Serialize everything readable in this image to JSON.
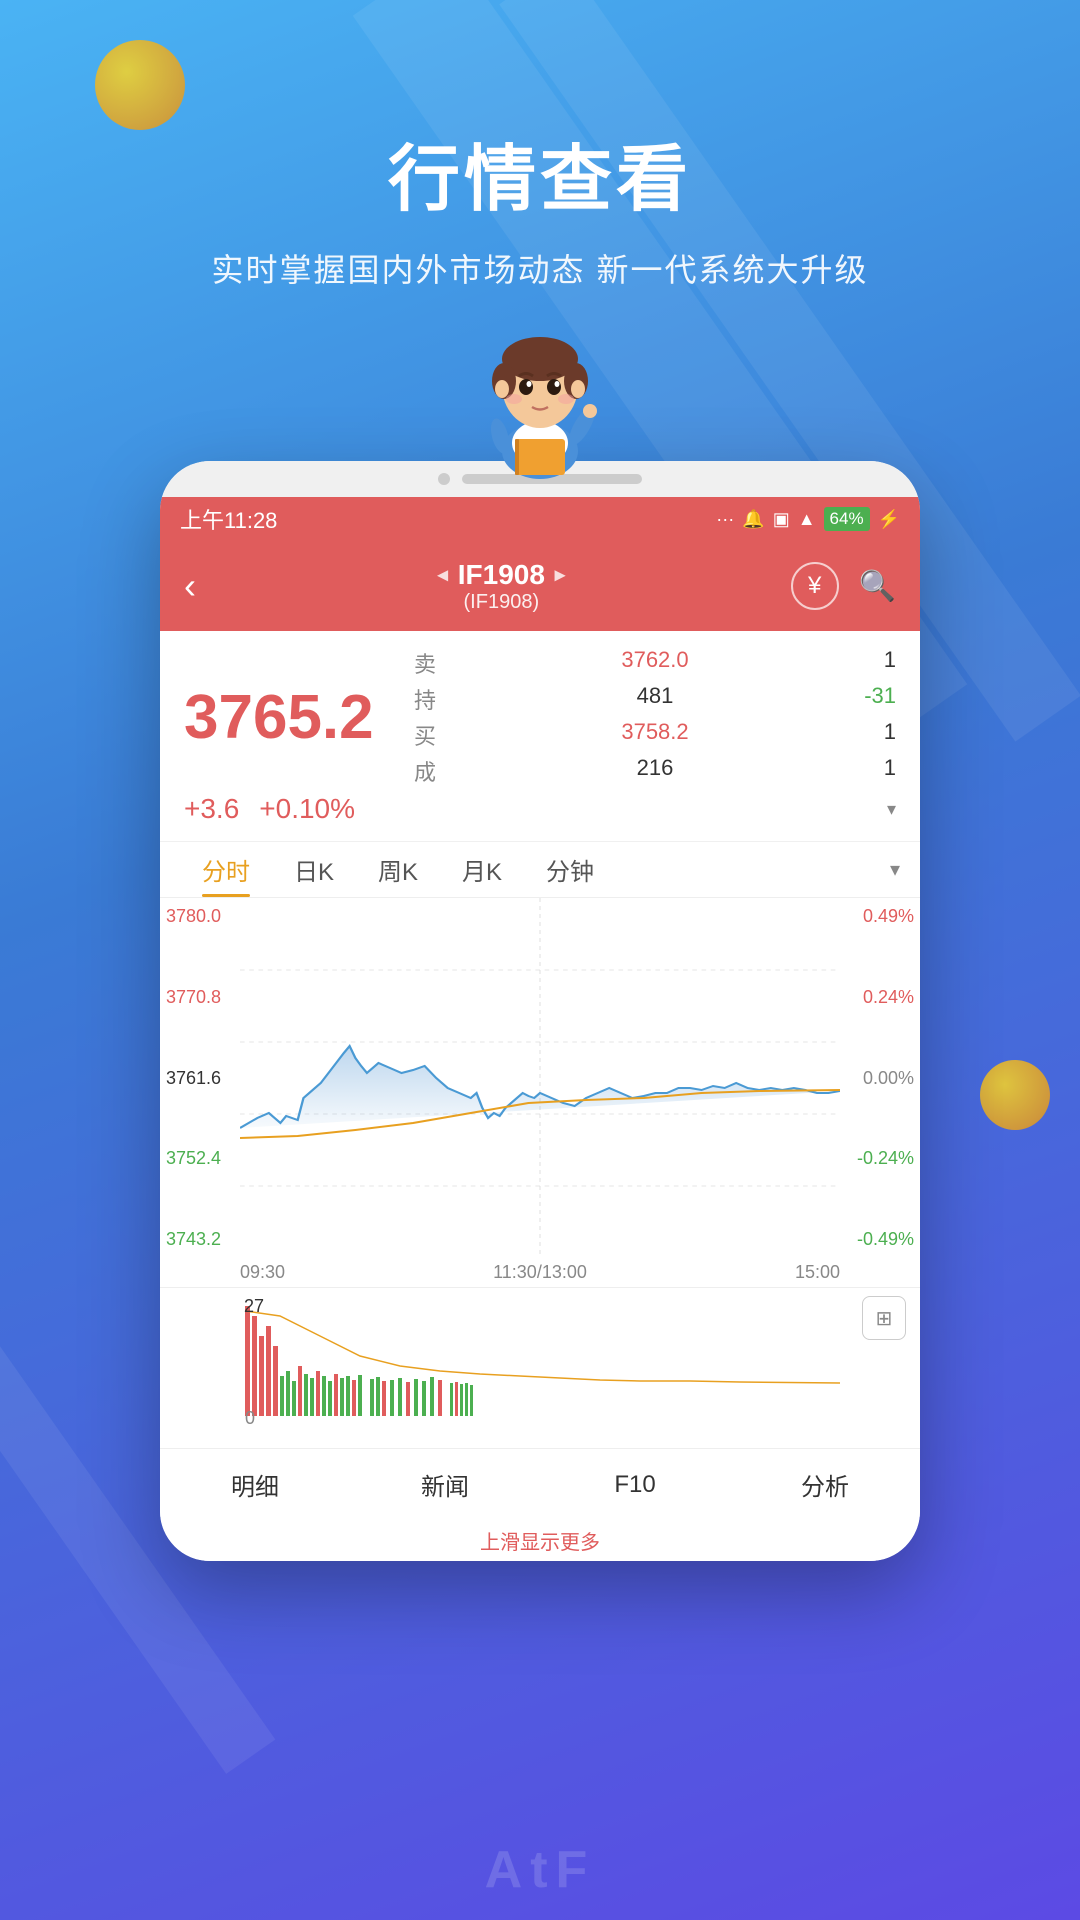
{
  "background": {
    "gradient_start": "#4ab3f4",
    "gradient_end": "#5c4ae4"
  },
  "hero": {
    "title": "行情查看",
    "subtitle": "实时掌握国内外市场动态 新一代系统大升级"
  },
  "status_bar": {
    "time": "上午11:28",
    "battery": "64%",
    "wifi": "WiFi"
  },
  "nav": {
    "back_label": "‹",
    "title": "IF1908",
    "subtitle": "(IF1908)",
    "left_arrow": "◂",
    "right_arrow": "▸"
  },
  "price": {
    "main": "3765.2",
    "change": "+3.6",
    "change_pct": "+0.10%",
    "sell_label": "卖",
    "sell_price": "3762.0",
    "sell_qty": "1",
    "hold_label": "持",
    "hold_qty": "481",
    "hold_change": "-31",
    "buy_label": "买",
    "buy_price": "3758.2",
    "buy_qty": "1",
    "trade_label": "成",
    "trade_qty": "216",
    "trade_val": "1"
  },
  "chart_tabs": [
    {
      "label": "分时",
      "active": true
    },
    {
      "label": "日K",
      "active": false
    },
    {
      "label": "周K",
      "active": false
    },
    {
      "label": "月K",
      "active": false
    },
    {
      "label": "分钟",
      "active": false
    }
  ],
  "chart_left_labels": [
    "3780.0",
    "3770.8",
    "3761.6",
    "3752.4",
    "3743.2"
  ],
  "chart_right_labels": [
    "0.49%",
    "0.24%",
    "0.00%",
    "-0.24%",
    "-0.49%"
  ],
  "chart_time_labels": [
    "09:30",
    "11:30/13:00",
    "15:00"
  ],
  "volume_label": "27",
  "volume_zero": "0",
  "bottom_tabs": [
    {
      "label": "明细"
    },
    {
      "label": "新闻"
    },
    {
      "label": "F10"
    },
    {
      "label": "分析"
    }
  ],
  "scroll_hint": "上滑显示更多",
  "atf": "AtF"
}
